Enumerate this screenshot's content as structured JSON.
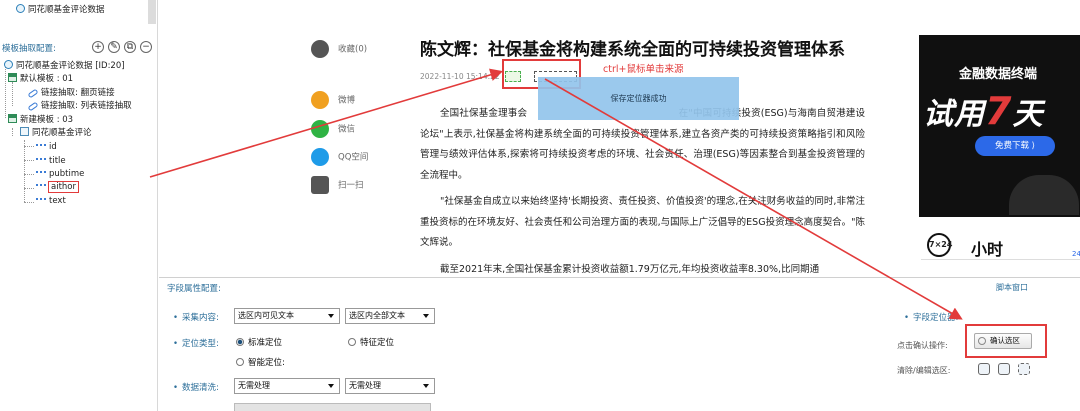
{
  "tree": {
    "top_item": "同花顺基金评论数据",
    "config_title": "模板抽取配置:",
    "root": "同花顺基金评论数据 [ID:20]",
    "default_template": "默认模板 : 01",
    "link_page": "链接抽取: 翻页链接",
    "link_list": "链接抽取: 列表链接抽取",
    "new_template": "新建模板 : 03",
    "table_name": "同花顺基金评论",
    "fields": [
      "id",
      "title",
      "pubtime",
      "aithor",
      "text"
    ]
  },
  "share": {
    "collect": "收藏(0)",
    "weibo": "微博",
    "wechat": "微信",
    "qq": "QQ空间",
    "scan": "扫一扫"
  },
  "article": {
    "title": "陈文辉：社保基金将构建系统全面的可持续投资管理体系",
    "datetime": "2022-11-10 15:14:22",
    "hint": "ctrl+鼠标单击来源",
    "toast": "保存定位器成功",
    "p1": "全国社保基金理事会 　　　　　　　　　　　　　　　 在\"中国可持续投资(ESG)与海南自贸港建设论坛\"上表示,社保基金将构建系统全面的可持续投资管理体系,建立各资产类的可持续投资策略指引和风险管理与绩效评估体系,探索将可持续投资考虑的环境、社会责任、治理(ESG)等因素整合到基金投资管理的全流程中。",
    "p2": "\"社保基金自成立以来始终坚持'长期投资、责任投资、价值投资'的理念,在关注财务收益的同时,非常注重投资标的在环境友好、社会责任和公司治理方面的表现,与国际上广泛倡导的ESG投资理念高度契合。\"陈文辉说。",
    "p3": "截至2021年末,全国社保基金累计投资收益额1.79万亿元,年均投资收益率8.30%,比同期通"
  },
  "ad": {
    "top": "金融数据终端",
    "big": "试用7天",
    "button": "免费下载 ⟩"
  },
  "news": {
    "logo": "7×24",
    "title": "小时",
    "more": "24"
  },
  "prop": {
    "title": "字段属性配置:",
    "script_window": "脚本窗口",
    "collect_label": "采集内容:",
    "collect_sel1": "选区内可见文本",
    "collect_sel2": "选区内全部文本",
    "locate_label": "定位类型:",
    "locate_std": "标准定位",
    "locate_feature": "特征定位",
    "locate_smart": "智能定位:",
    "clean_label": "数据清洗:",
    "clean_sel1": "无需处理",
    "clean_sel2": "无需处理",
    "locator_label": "字段定位器:",
    "click_confirm": "点击确认操作:",
    "confirm_btn": "确认选区",
    "clear_edit": "清除/编辑选区:"
  },
  "colors": {
    "accent": "#2d6f9a",
    "annotation_red": "#e23b3b",
    "toast_bg": "#92c4ec"
  }
}
